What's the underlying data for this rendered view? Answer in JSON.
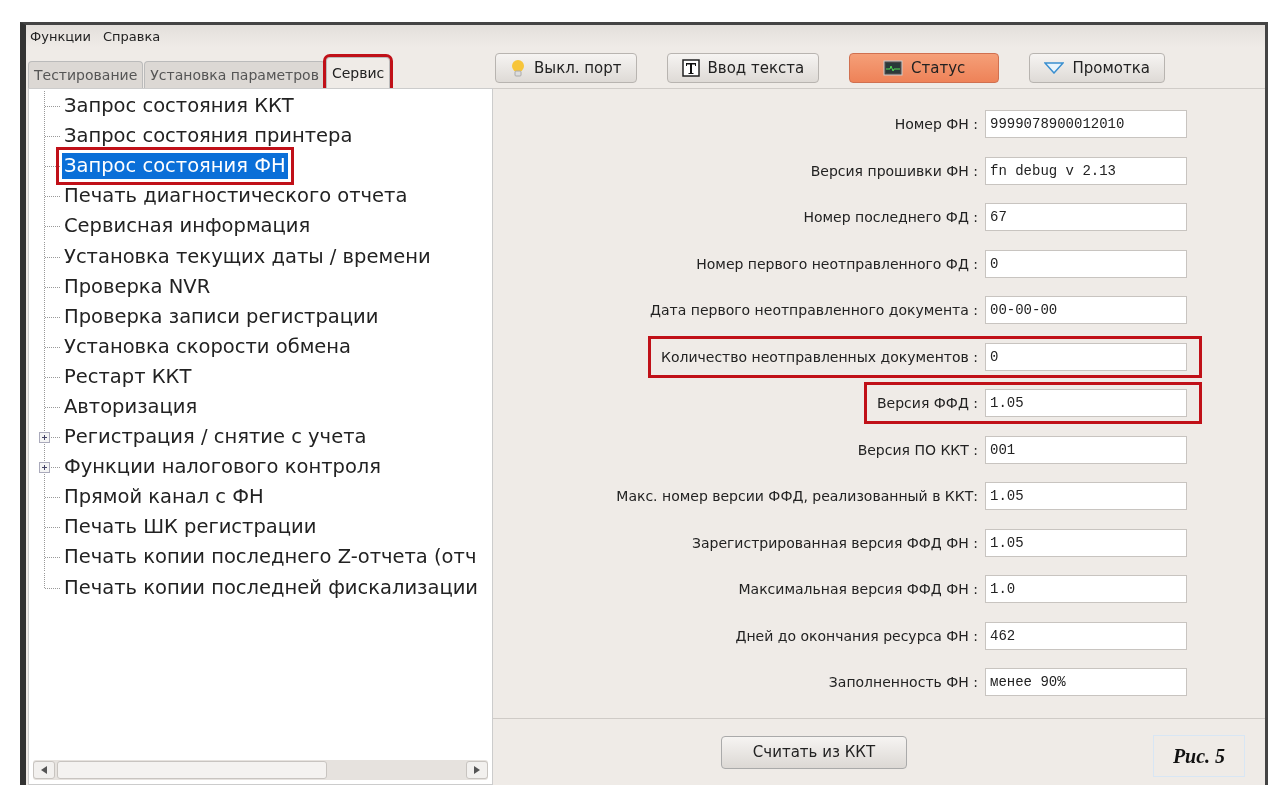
{
  "menu": [
    "Функции",
    "Справка"
  ],
  "tabs": [
    {
      "label": "Тестирование",
      "selected": false,
      "highlighted": false
    },
    {
      "label": "Установка параметров",
      "selected": false,
      "highlighted": false
    },
    {
      "label": "Сервис",
      "selected": true,
      "highlighted": true
    }
  ],
  "toolbar": [
    {
      "label": "Выкл. порт",
      "kind": "port",
      "selected": false
    },
    {
      "label": "Ввод текста",
      "kind": "text",
      "selected": false
    },
    {
      "label": "Статус",
      "kind": "status",
      "selected": true
    },
    {
      "label": "Промотка",
      "kind": "feed",
      "selected": false
    }
  ],
  "tree": [
    {
      "label": "Запрос состояния ККТ",
      "selected": false,
      "highlighted": false
    },
    {
      "label": "Запрос состояния принтера",
      "selected": false,
      "highlighted": false
    },
    {
      "label": "Запрос состояния ФН",
      "selected": true,
      "highlighted": true
    },
    {
      "label": "Печать диагностического отчета",
      "selected": false,
      "highlighted": false
    },
    {
      "label": "Сервисная информация",
      "selected": false,
      "highlighted": false
    },
    {
      "label": "Установка текущих даты / времени",
      "selected": false,
      "highlighted": false
    },
    {
      "label": "Проверка NVR",
      "selected": false,
      "highlighted": false
    },
    {
      "label": "Проверка записи регистрации",
      "selected": false,
      "highlighted": false
    },
    {
      "label": "Установка скорости обмена",
      "selected": false,
      "highlighted": false
    },
    {
      "label": "Рестарт ККТ",
      "selected": false,
      "highlighted": false
    },
    {
      "label": "Авторизация",
      "selected": false,
      "highlighted": false
    },
    {
      "label": "Регистрация / снятие с учета",
      "selected": false,
      "highlighted": false,
      "expanded": false
    },
    {
      "label": "Функции налогового контроля",
      "selected": false,
      "highlighted": false,
      "expanded": false
    },
    {
      "label": "Прямой канал с ФН",
      "selected": false,
      "highlighted": false
    },
    {
      "label": "Печать ШК регистрации",
      "selected": false,
      "highlighted": false
    },
    {
      "label": "Печать копии последнего Z-отчета (отч",
      "selected": false,
      "highlighted": false
    },
    {
      "label": "Печать копии последней фискализации",
      "selected": false,
      "highlighted": false
    }
  ],
  "fields": [
    {
      "label": "Номер ФН :",
      "value": "9999078900012010",
      "highlighted": false
    },
    {
      "label": "Версия прошивки ФН :",
      "value": "fn debug v 2.13",
      "highlighted": false
    },
    {
      "label": "Номер последнего ФД :",
      "value": "67",
      "highlighted": false
    },
    {
      "label": "Номер первого неотправленного ФД :",
      "value": "0",
      "highlighted": false
    },
    {
      "label": "Дата первого неотправленного документа :",
      "value": "00-00-00",
      "highlighted": false
    },
    {
      "label": "Количество неотправленных документов :",
      "value": "0",
      "highlighted": true
    },
    {
      "label": "Версия ФФД :",
      "value": "1.05",
      "highlighted": true
    },
    {
      "label": "Версия ПО ККТ :",
      "value": "001",
      "highlighted": false
    },
    {
      "label": "Макс. номер версии ФФД, реализованный в ККТ:",
      "value": "1.05",
      "highlighted": false
    },
    {
      "label": "Зарегистрированная версия ФФД ФН :",
      "value": "1.05",
      "highlighted": false
    },
    {
      "label": "Максимальная версия ФФД ФН :",
      "value": "1.0",
      "highlighted": false
    },
    {
      "label": "Дней до окончания ресурса ФН :",
      "value": "462",
      "highlighted": false
    },
    {
      "label": "Заполненность ФН :",
      "value": "менее 90%",
      "highlighted": false
    }
  ],
  "read_button": "Считать из ККТ",
  "caption": "Рис. 5"
}
